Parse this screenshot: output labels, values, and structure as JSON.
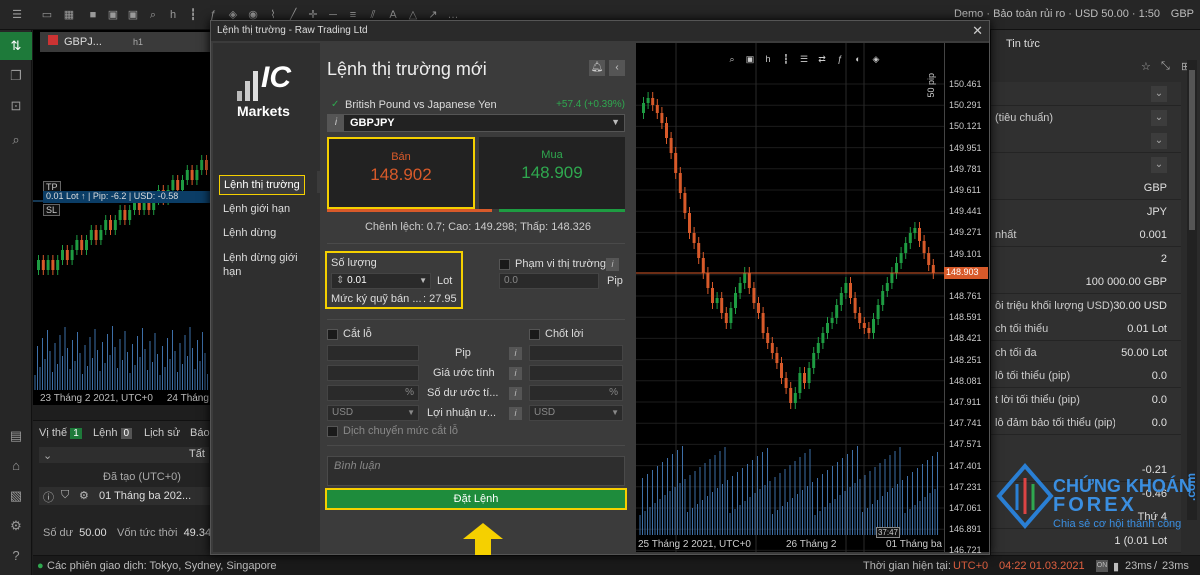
{
  "topbar": {
    "account_text": "Demo · Bảo toàn rủi ro · USD 50.00 · 1:50",
    "currency": "GBP"
  },
  "bgchart": {
    "tab_label": "GBPJ...",
    "tab_timeframe": "h1",
    "tp_tag": "TP",
    "sl_tag": "SL",
    "lot_line": "0.01 Lot ↑ | Pip: -6.2 | USD: -0.58",
    "date_label": "23 Tháng 2 2021, UTC+0",
    "date_label2": "24 Tháng"
  },
  "pospanel": {
    "tab_positions": "Vị thế",
    "positions_count": "1",
    "tab_orders": "Lệnh",
    "orders_count": "0",
    "tab_history": "Lịch sử",
    "tab_report": "Báo",
    "filter_label": "Tất",
    "col_created": "Đã tạo (UTC+0)",
    "row_created": "01 Tháng ba 202...",
    "balance_label": "Số dư",
    "balance_value": "50.00",
    "equity_label": "Vốn tức thời",
    "equity_value": "49.34"
  },
  "statusbar": {
    "sessions": "Các phiên giao dịch: Tokyo, Sydney, Singapore",
    "server_time_label": "Thời gian hiện tại:",
    "timezone": "UTC+0",
    "datetime": "04:22 01.03.2021",
    "latency1": "23ms",
    "latency2": "23ms"
  },
  "rightpanel": {
    "tab_news": "Tin tức",
    "rows": [
      {
        "label": "",
        "value": ""
      },
      {
        "label": "(tiêu chuẩn)",
        "value": ""
      },
      {
        "label": "",
        "value": ""
      },
      {
        "label": "",
        "value": ""
      },
      {
        "label": "",
        "value": "GBP"
      },
      {
        "label": "",
        "value": "JPY"
      },
      {
        "label": "nhất",
        "value": "0.001"
      },
      {
        "label": "",
        "value": "2"
      },
      {
        "label": "",
        "value": "100 000.00 GBP"
      },
      {
        "label": "ỗi triệu khối lượng USD)",
        "value": "30.00 USD"
      },
      {
        "label": "ch tối thiểu",
        "value": "0.01 Lot"
      },
      {
        "label": "ch tối đa",
        "value": "50.00 Lot"
      },
      {
        "label": "lỗ tối thiểu (pip)",
        "value": "0.0"
      },
      {
        "label": "t lời tối thiểu (pip)",
        "value": "0.0"
      },
      {
        "label": "lỗ đảm bảo tối thiểu (pip)",
        "value": "0.0"
      },
      {
        "label": "",
        "value": ""
      },
      {
        "label": "",
        "value": "-0.21"
      },
      {
        "label": "",
        "value": "-0.46"
      },
      {
        "label": "",
        "value": "Thứ 4"
      },
      {
        "label": "",
        "value": "1 (0.01 Lot"
      }
    ]
  },
  "dialog": {
    "title": "Lệnh thị trường - Raw Trading Ltd",
    "close": "✕",
    "logo_ic": "IC",
    "logo_markets": "Markets",
    "menu": {
      "market": "Lệnh thị trường",
      "limit": "Lệnh giới hạn",
      "stop": "Lệnh dừng",
      "stop_limit": "Lệnh dừng giới hạn"
    },
    "form_title": "Lệnh thị trường mới",
    "symbol_name": "British Pound vs Japanese Yen",
    "symbol_change": "+57.4 (+0.39%)",
    "symbol_code": "GBPJPY",
    "sell_label": "Bán",
    "sell_price": "148.902",
    "buy_label": "Mua",
    "buy_price": "148.909",
    "spread_text": "Chênh lệch: 0.7; Cao: 149.298; Thấp: 148.326",
    "volume_label": "Số lượng",
    "volume_value": "0.01",
    "volume_unit": "Lot",
    "margin_label": "Mức ký quỹ bán ...",
    "margin_value": ": 27.95",
    "range_label": "Phạm vi thị trường",
    "range_value": "0.0",
    "range_unit": "Pip",
    "sl_label": "Cắt lỗ",
    "tp_label": "Chốt lời",
    "row_pip": "Pip",
    "row_est_price": "Giá ước tính",
    "row_est_balance": "Số dư ước tí...",
    "row_est_profit": "Lợi nhuận ư...",
    "pct": "%",
    "usd": "USD",
    "trailing_label": "Dịch chuyển mức cắt lỗ",
    "comment_placeholder": "Bình luận",
    "place_button": "Đặt Lệnh"
  },
  "dchart": {
    "price_labels": [
      "150.461",
      "150.291",
      "150.121",
      "149.951",
      "149.781",
      "149.611",
      "149.441",
      "149.271",
      "149.101",
      "148.931",
      "148.761",
      "148.591",
      "148.421",
      "148.251",
      "148.081",
      "147.911",
      "147.741",
      "147.571",
      "147.401",
      "147.231",
      "147.061",
      "146.891",
      "146.721"
    ],
    "current_price": "148.903",
    "pip_label": "50 pip",
    "x_label1": "25 Tháng 2 2021, UTC+0",
    "x_label2": "26 Tháng 2",
    "x_label3": "01 Tháng ba",
    "time_tag": "37:47"
  },
  "watermark": {
    "line1": "CHỨNG KHOÁN",
    "line2": "FOREX",
    "line3": "Chia sẻ cơ hội thành công",
    "line4": ".com"
  },
  "colors": {
    "accent_green": "#1e8c3c",
    "sell_red": "#d85a2a",
    "highlight_yellow": "#f5d000"
  }
}
